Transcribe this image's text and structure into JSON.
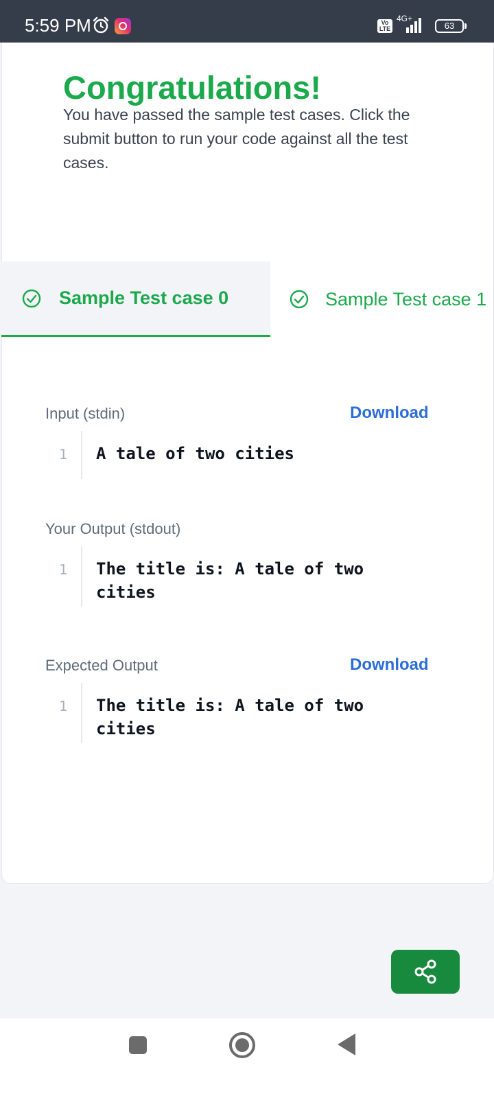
{
  "status_bar": {
    "time": "5:59 PM",
    "network": "4G+",
    "volte": "Vo LTE",
    "battery": "63"
  },
  "result": {
    "headline": "Congratulations!",
    "message": "You have passed the sample test cases. Click the submit button to run your code against all the test cases."
  },
  "tabs": [
    {
      "label": "Sample Test case 0",
      "active": true
    },
    {
      "label": "Sample Test case 1",
      "active": false
    }
  ],
  "input": {
    "label": "Input (stdin)",
    "download": "Download",
    "line_number": "1",
    "code": "A tale of two cities"
  },
  "your_output": {
    "label": "Your Output (stdout)",
    "line_number": "1",
    "code": "The title is: A tale of two cities"
  },
  "expected_output": {
    "label": "Expected Output",
    "download": "Download",
    "line_number": "1",
    "code": "The title is: A tale of two cities"
  },
  "colors": {
    "success": "#1ba94c",
    "link": "#2c6ed8",
    "share_button": "#178a3e",
    "status_bar": "#363d4a"
  },
  "icons": {
    "share": "share-icon",
    "check": "check-circle-icon"
  }
}
